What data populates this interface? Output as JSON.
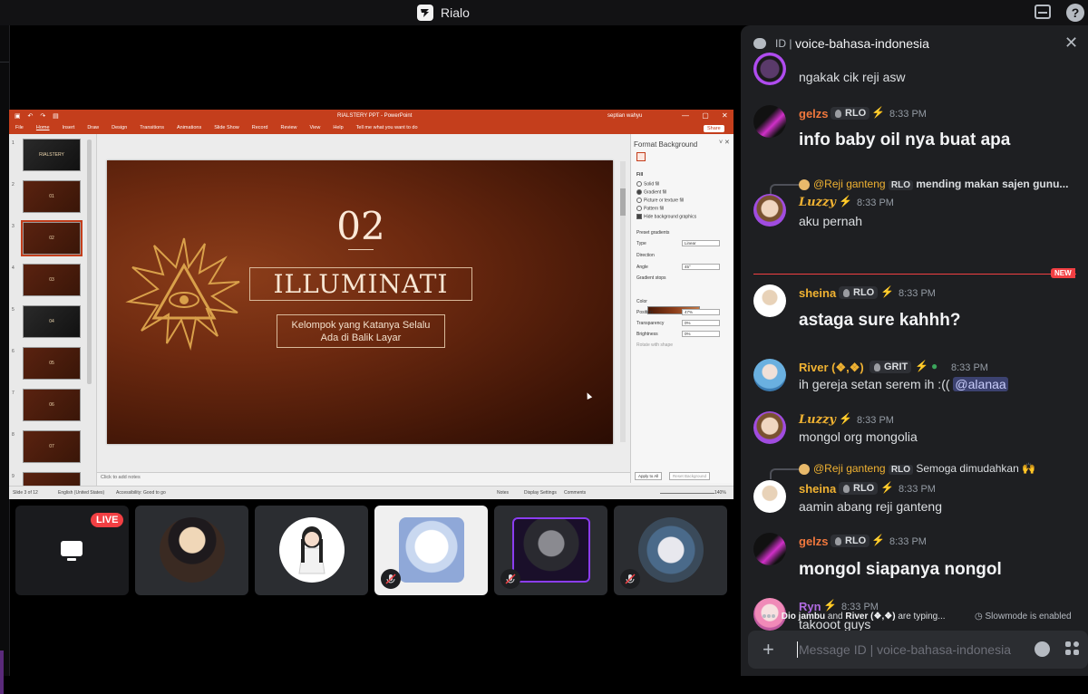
{
  "window": {
    "app_title": "Rialo"
  },
  "ppt": {
    "doc_title": "RIALSTERY PPT  -  PowerPoint",
    "user": "septian wahyu",
    "tabs": [
      "File",
      "Home",
      "Insert",
      "Draw",
      "Design",
      "Transitions",
      "Animations",
      "Slide Show",
      "Record",
      "Review",
      "View",
      "Help",
      "Tell me what you want to do"
    ],
    "share": "Share",
    "thumbnails": [
      {
        "num": "1",
        "label": "RIALSTERY"
      },
      {
        "num": "2",
        "label": "01"
      },
      {
        "num": "3",
        "label": "02"
      },
      {
        "num": "4",
        "label": "03"
      },
      {
        "num": "5",
        "label": "04"
      },
      {
        "num": "6",
        "label": "05"
      },
      {
        "num": "7",
        "label": "06"
      },
      {
        "num": "8",
        "label": "07"
      },
      {
        "num": "9",
        "label": ""
      }
    ],
    "slide": {
      "number": "02",
      "title": "ILLUMINATI",
      "subtitle_line1": "Kelompok yang Katanya Selalu",
      "subtitle_line2": "Ada di Balik Layar"
    },
    "notes_placeholder": "Click to add notes",
    "pane": {
      "title": "Format Background",
      "fill_heading": "Fill",
      "options": [
        "Solid fill",
        "Gradient fill",
        "Picture or texture fill",
        "Pattern fill",
        "Hide background graphics"
      ],
      "preset_label": "Preset gradients",
      "type_label": "Type",
      "type_value": "Linear",
      "direction_label": "Direction",
      "angle_label": "Angle",
      "angle_value": "45°",
      "stops_label": "Gradient stops",
      "color_label": "Color",
      "position_label": "Position",
      "position_value": "47%",
      "transparency_label": "Transparency",
      "transparency_value": "0%",
      "brightness_label": "Brightness",
      "brightness_value": "0%",
      "rotate_label": "Rotate with shape",
      "apply_all": "Apply to All",
      "reset": "Reset Background"
    },
    "status": {
      "slide": "Slide 3 of 12",
      "language": "English (United States)",
      "accessibility": "Accessibility: Good to go",
      "notes": "Notes",
      "display": "Display Settings",
      "comments": "Comments",
      "zoom": "140%"
    }
  },
  "tiles": {
    "live_label": "LIVE"
  },
  "chat": {
    "channel_tag": "ID",
    "channel_name": "voice-bahasa-indonesia",
    "messages": [
      {
        "text": "ngakak cik reji asw"
      },
      {
        "user": "gelzs",
        "tag": "RLO",
        "time": "8:33 PM",
        "text": "info baby oil nya buat apa"
      },
      {
        "reply_user": "@Reji ganteng",
        "reply_tag": "RLO",
        "reply_text": "mending makan sajen gunu...",
        "user": "Luzzy",
        "time": "8:33 PM",
        "text": "aku pernah"
      },
      {
        "user": "sheina",
        "tag": "RLO",
        "time": "8:33 PM",
        "text": "astaga sure kahhh?"
      },
      {
        "user": "River (❖,❖)",
        "tag": "GRIT",
        "time": "8:33 PM",
        "text": "ih gereja setan serem ih :((",
        "mention": "@alanaa"
      },
      {
        "user": "Luzzy",
        "time": "8:33 PM",
        "text": "mongol org mongolia"
      },
      {
        "reply_user": "@Reji ganteng",
        "reply_tag": "RLO",
        "reply_text": "Semoga dimudahkan 🙌",
        "user": "sheina",
        "tag": "RLO",
        "time": "8:33 PM",
        "text": "aamin abang reji ganteng"
      },
      {
        "user": "gelzs",
        "tag": "RLO",
        "time": "8:33 PM",
        "text": "mongol siapanya nongol"
      },
      {
        "user": "Ryn",
        "time": "8:33 PM",
        "text": "takooot guys"
      }
    ],
    "new_badge": "NEW",
    "typing_user1": "Dio jambu",
    "typing_and": "and",
    "typing_user2": "River (❖,❖)",
    "typing_suffix": "are typing...",
    "slowmode": "Slowmode is enabled",
    "composer_placeholder": "Message ID | voice-bahasa-indonesia"
  }
}
